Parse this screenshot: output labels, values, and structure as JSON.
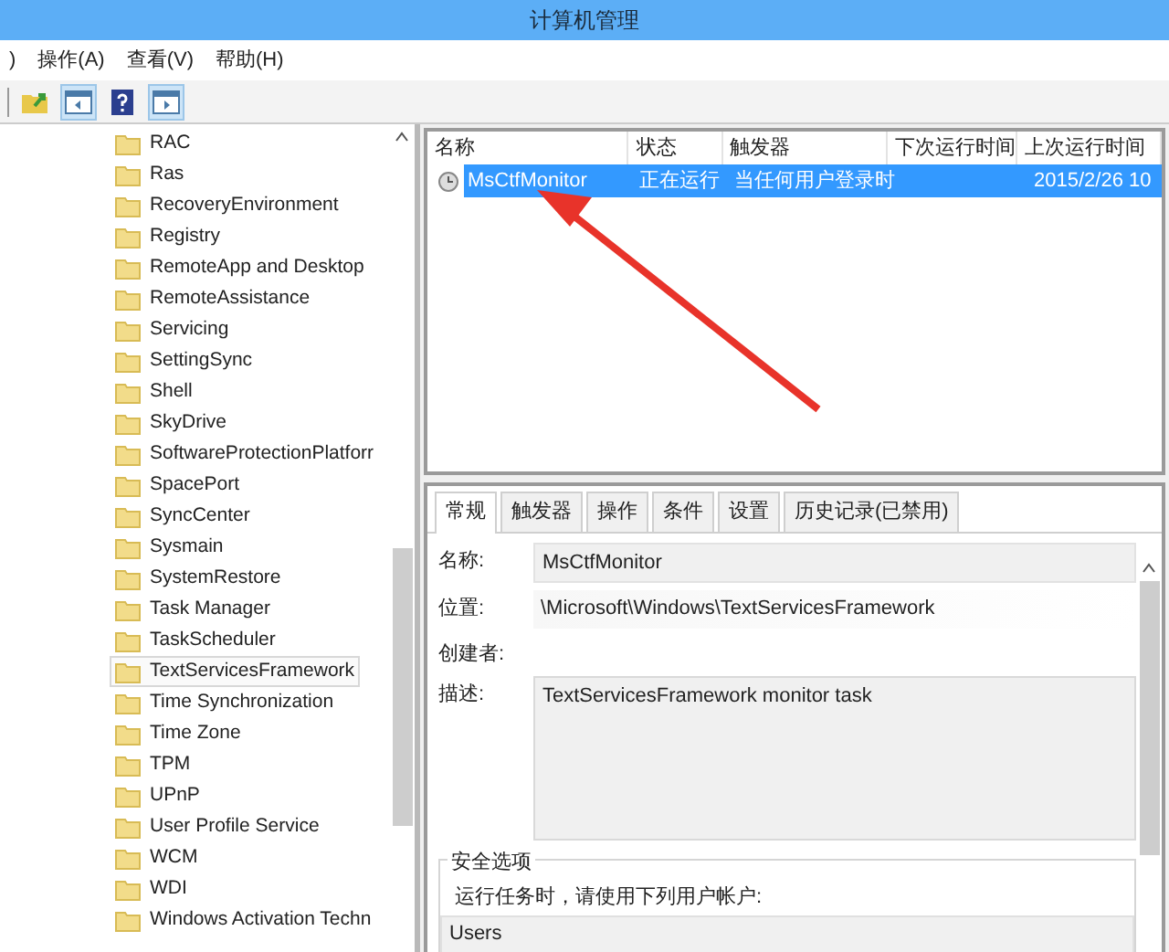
{
  "window": {
    "title": "计算机管理"
  },
  "menu": [
    ")",
    "操作(A)",
    "查看(V)",
    "帮助(H)"
  ],
  "toolbar": [
    {
      "kind": "folder",
      "pressed": false
    },
    {
      "kind": "panel-left",
      "pressed": true
    },
    {
      "kind": "help",
      "pressed": false
    },
    {
      "kind": "panel-right",
      "pressed": true
    }
  ],
  "tree": {
    "items": [
      {
        "label": "RAC",
        "selected": false
      },
      {
        "label": "Ras",
        "selected": false
      },
      {
        "label": "RecoveryEnvironment",
        "selected": false
      },
      {
        "label": "Registry",
        "selected": false
      },
      {
        "label": "RemoteApp and Desktop",
        "selected": false
      },
      {
        "label": "RemoteAssistance",
        "selected": false
      },
      {
        "label": "Servicing",
        "selected": false
      },
      {
        "label": "SettingSync",
        "selected": false
      },
      {
        "label": "Shell",
        "selected": false
      },
      {
        "label": "SkyDrive",
        "selected": false
      },
      {
        "label": "SoftwareProtectionPlatforr",
        "selected": false
      },
      {
        "label": "SpacePort",
        "selected": false
      },
      {
        "label": "SyncCenter",
        "selected": false
      },
      {
        "label": "Sysmain",
        "selected": false
      },
      {
        "label": "SystemRestore",
        "selected": false
      },
      {
        "label": "Task Manager",
        "selected": false
      },
      {
        "label": "TaskScheduler",
        "selected": false
      },
      {
        "label": "TextServicesFramework",
        "selected": true
      },
      {
        "label": "Time Synchronization",
        "selected": false
      },
      {
        "label": "Time Zone",
        "selected": false
      },
      {
        "label": "TPM",
        "selected": false
      },
      {
        "label": "UPnP",
        "selected": false
      },
      {
        "label": "User Profile Service",
        "selected": false
      },
      {
        "label": "WCM",
        "selected": false
      },
      {
        "label": "WDI",
        "selected": false
      },
      {
        "label": "Windows Activation Techn",
        "selected": false
      }
    ]
  },
  "task_list": {
    "columns": [
      "名称",
      "状态",
      "触发器",
      "下次运行时间",
      "上次运行时间"
    ],
    "rows": [
      {
        "name": "MsCtfMonitor",
        "status": "正在运行",
        "trigger": "当任何用户登录时",
        "last_run": "2015/2/26 10",
        "selected": true
      }
    ]
  },
  "details": {
    "tabs": [
      {
        "label": "常规",
        "selected": true
      },
      {
        "label": "触发器",
        "selected": false
      },
      {
        "label": "操作",
        "selected": false
      },
      {
        "label": "条件",
        "selected": false
      },
      {
        "label": "设置",
        "selected": false
      },
      {
        "label": "历史记录(已禁用)",
        "selected": false
      }
    ],
    "fields": [
      {
        "label": "名称:",
        "value": "MsCtfMonitor",
        "kind": "box"
      },
      {
        "label": "位置:",
        "value": "\\Microsoft\\Windows\\TextServicesFramework",
        "kind": "plain"
      },
      {
        "label": "创建者:",
        "kind": "plain"
      },
      {
        "label": "描述:",
        "value": "TextServicesFramework monitor task",
        "kind": "area"
      }
    ],
    "security": {
      "title": "安全选项",
      "prompt": "运行任务时，请使用下列用户帐户:",
      "account": "Users"
    }
  }
}
